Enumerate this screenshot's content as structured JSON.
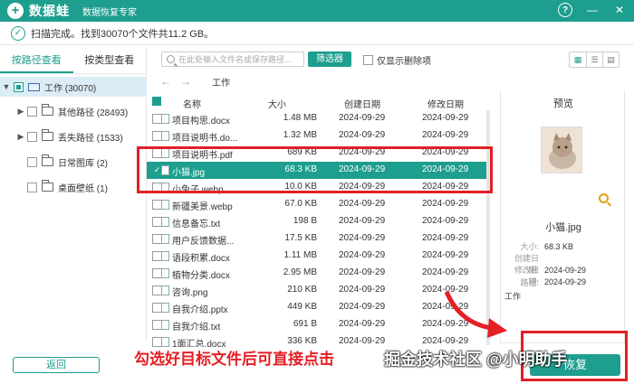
{
  "app": {
    "logo_mark": "+",
    "name": "数据蛙",
    "subtitle": "数据恢复专家"
  },
  "window": {
    "help": "?",
    "minimize": "—",
    "close": "✕"
  },
  "status": {
    "text": "扫描完成。找到30070个文件共11.2 GB。"
  },
  "left": {
    "tabs": [
      "按路径查看",
      "按类型查看"
    ],
    "tree": [
      {
        "label": "工作 (30070)"
      },
      {
        "label": "其他路径 (28493)"
      },
      {
        "label": "丢失路径 (1533)"
      },
      {
        "label": "日常图库 (2)"
      },
      {
        "label": "桌面壁纸 (1)"
      }
    ],
    "back_label": "返回"
  },
  "toolbar": {
    "search_placeholder": "在此处输入文件名或保存路径...",
    "filter_label": "筛选器",
    "deleted_only_label": "仅显示删除项"
  },
  "breadcrumb": {
    "current": "工作"
  },
  "columns": {
    "name": "名称",
    "size": "大小",
    "created": "创建日期",
    "modified": "修改日期"
  },
  "files": [
    {
      "name": "项目构思.docx",
      "size": "1.48 MB",
      "created": "2024-09-29",
      "modified": "2024-09-29"
    },
    {
      "name": "项目说明书.do...",
      "size": "1.32 MB",
      "created": "2024-09-29",
      "modified": "2024-09-29"
    },
    {
      "name": "项目说明书.pdf",
      "size": "689 KB",
      "created": "2024-09-29",
      "modified": "2024-09-29"
    },
    {
      "name": "小猫.jpg",
      "size": "68.3 KB",
      "created": "2024-09-29",
      "modified": "2024-09-29"
    },
    {
      "name": "小兔子.webp",
      "size": "10.0 KB",
      "created": "2024-09-29",
      "modified": "2024-09-29"
    },
    {
      "name": "新疆美景.webp",
      "size": "67.0 KB",
      "created": "2024-09-29",
      "modified": "2024-09-29"
    },
    {
      "name": "信息备忘.txt",
      "size": "198 B",
      "created": "2024-09-29",
      "modified": "2024-09-29"
    },
    {
      "name": "用户反馈数据...",
      "size": "17.5 KB",
      "created": "2024-09-29",
      "modified": "2024-09-29"
    },
    {
      "name": "语段积累.docx",
      "size": "1.11 MB",
      "created": "2024-09-29",
      "modified": "2024-09-29"
    },
    {
      "name": "植物分类.docx",
      "size": "2.95 MB",
      "created": "2024-09-29",
      "modified": "2024-09-29"
    },
    {
      "name": "咨询.png",
      "size": "210 KB",
      "created": "2024-09-29",
      "modified": "2024-09-29"
    },
    {
      "name": "自我介绍.pptx",
      "size": "449 KB",
      "created": "2024-09-29",
      "modified": "2024-09-29"
    },
    {
      "name": "自我介绍.txt",
      "size": "691 B",
      "created": "2024-09-29",
      "modified": "2024-09-29"
    },
    {
      "name": "1面汇总.docx",
      "size": "336 KB",
      "created": "2024-09-29",
      "modified": "2024-09-29"
    }
  ],
  "preview": {
    "title": "预览",
    "filename": "小猫.jpg",
    "size_label": "大小:",
    "size": "68.3 KB",
    "created_label": "创建日期:",
    "created": "2024-09-29",
    "modified_label": "修改日期:",
    "modified": "2024-09-29",
    "path_label": "路径:",
    "path": "工作"
  },
  "recover_label": "恢复",
  "caption": "勾选好目标文件后可直接点击",
  "watermark": "掘金技术社区 @小明助手",
  "colors": {
    "brand": "#1e9e8e",
    "highlight": "#e41f25"
  }
}
